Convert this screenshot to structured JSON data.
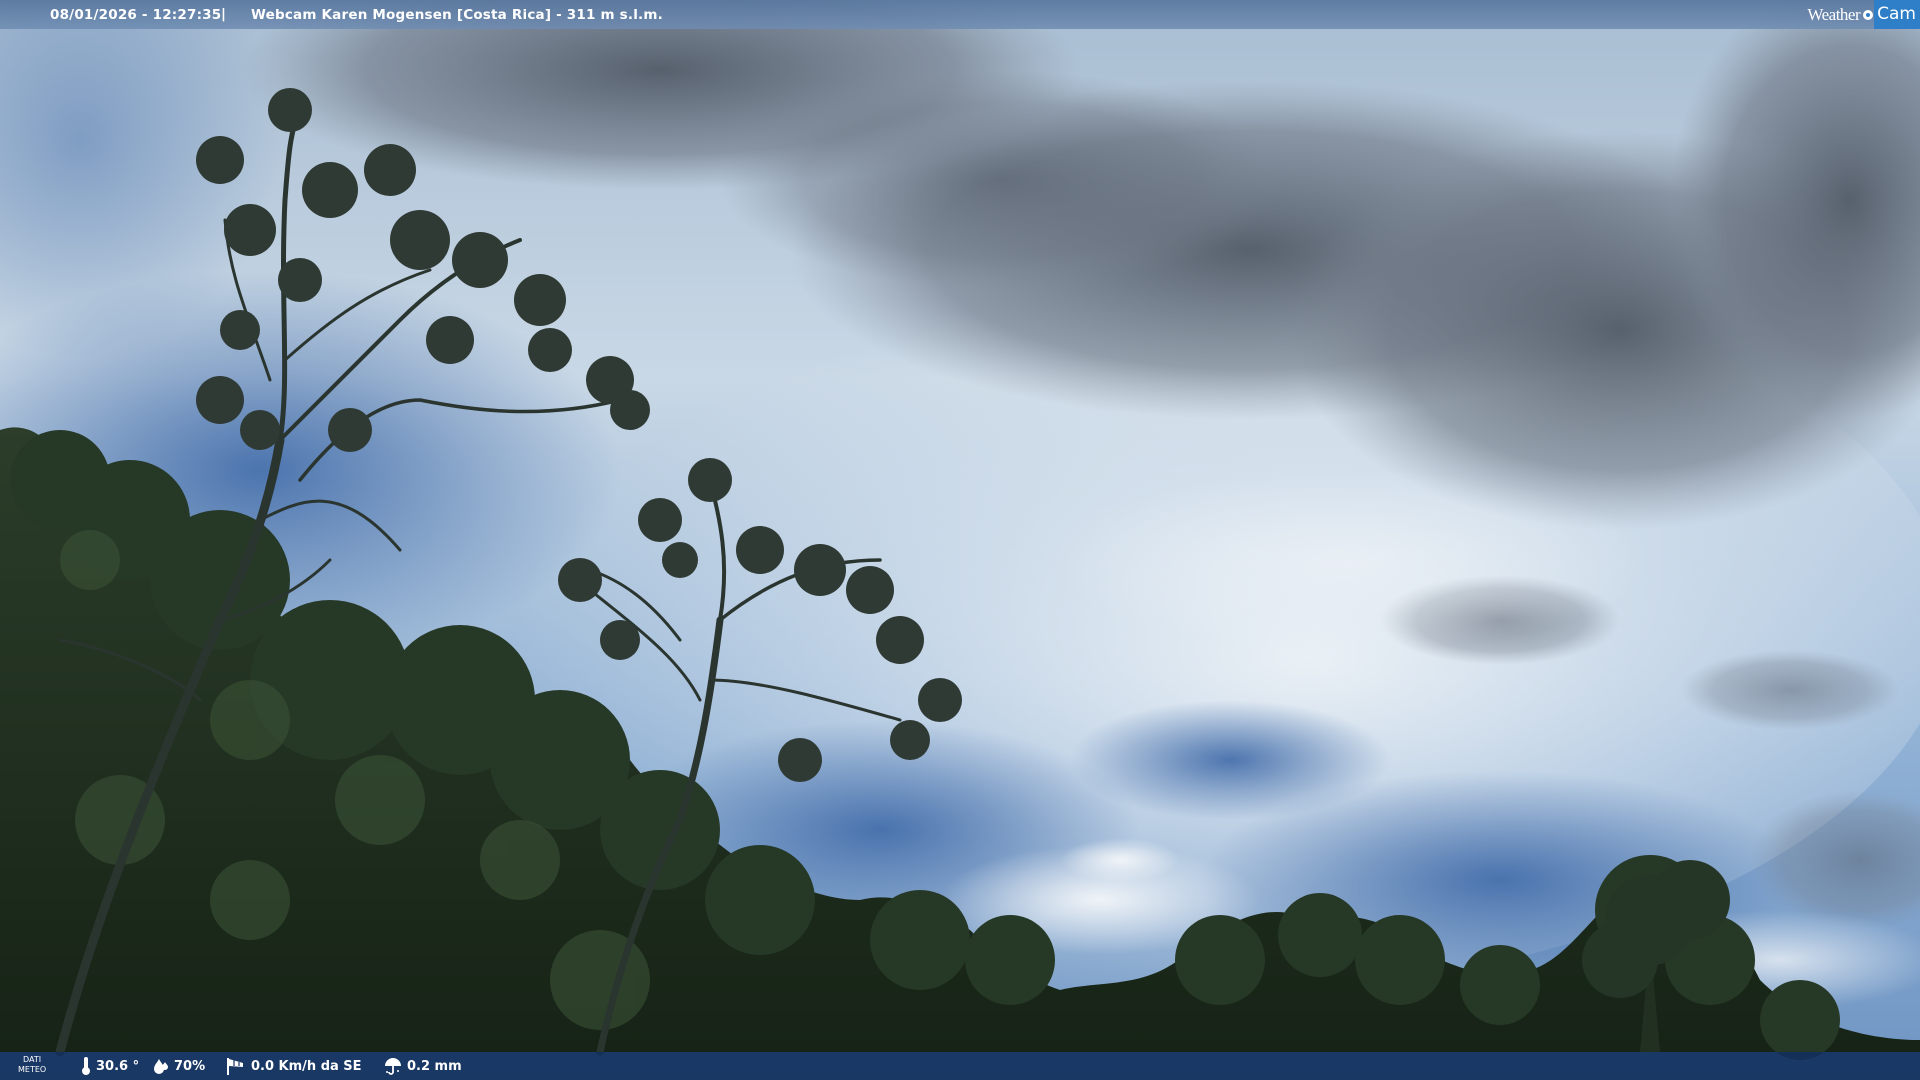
{
  "header": {
    "timestamp": "08/01/2026 - 12:27:35",
    "separator": "|",
    "title": "Webcam Karen Mogensen [Costa Rica]  - 311 m s.l.m.",
    "logo_left": "Weather",
    "logo_right": "Cam"
  },
  "footer": {
    "meteo_line1": "DATI",
    "meteo_line2": "METEO",
    "temperature": "30.6 °",
    "humidity": "70%",
    "wind": "0.0 Km/h da SE",
    "rain": "0.2 mm"
  },
  "icons": {
    "temperature": "thermometer-icon",
    "humidity": "humidity-drop-icon",
    "wind": "wind-sock-icon",
    "rain": "umbrella-icon"
  },
  "colors": {
    "sky_light": "#dbe6ef",
    "sky_blue": "#4f78b0",
    "cloud_dark": "#5d6674",
    "foliage": "#1f2e1f",
    "footer_bg": "#12305c",
    "logo_blue": "#2f7fc8"
  }
}
